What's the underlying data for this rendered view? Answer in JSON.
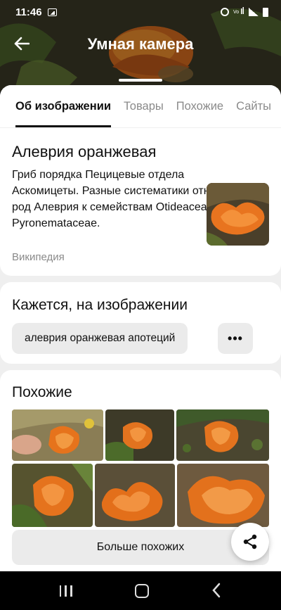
{
  "status_bar": {
    "time": "11:46",
    "icons": [
      "gallery-icon",
      "alarm-icon",
      "volte-icon",
      "signal-icon",
      "battery-icon"
    ]
  },
  "header": {
    "title": "Умная камера",
    "back_icon": "arrow-left-icon"
  },
  "tabs": [
    {
      "label": "Об изображении",
      "active": true
    },
    {
      "label": "Товары",
      "active": false
    },
    {
      "label": "Похожие",
      "active": false
    },
    {
      "label": "Сайты",
      "active": false
    }
  ],
  "info": {
    "title": "Алеврия оранжевая",
    "description": "Гриб порядка Пецицевые отдела Аскомицеты. Разные систематики относят род Алеврия к семействам Otideaceae или Pyronemataceae.",
    "source": "Википедия"
  },
  "seems": {
    "title": "Кажется, на изображении",
    "chip": "алеврия оранжевая апотеций",
    "more": "•••"
  },
  "similar": {
    "title": "Похожие",
    "more_button": "Больше похожих"
  },
  "colors": {
    "accent_orange": "#e8741f",
    "sheet_bg": "#efefef",
    "chip_bg": "#ebebeb"
  }
}
